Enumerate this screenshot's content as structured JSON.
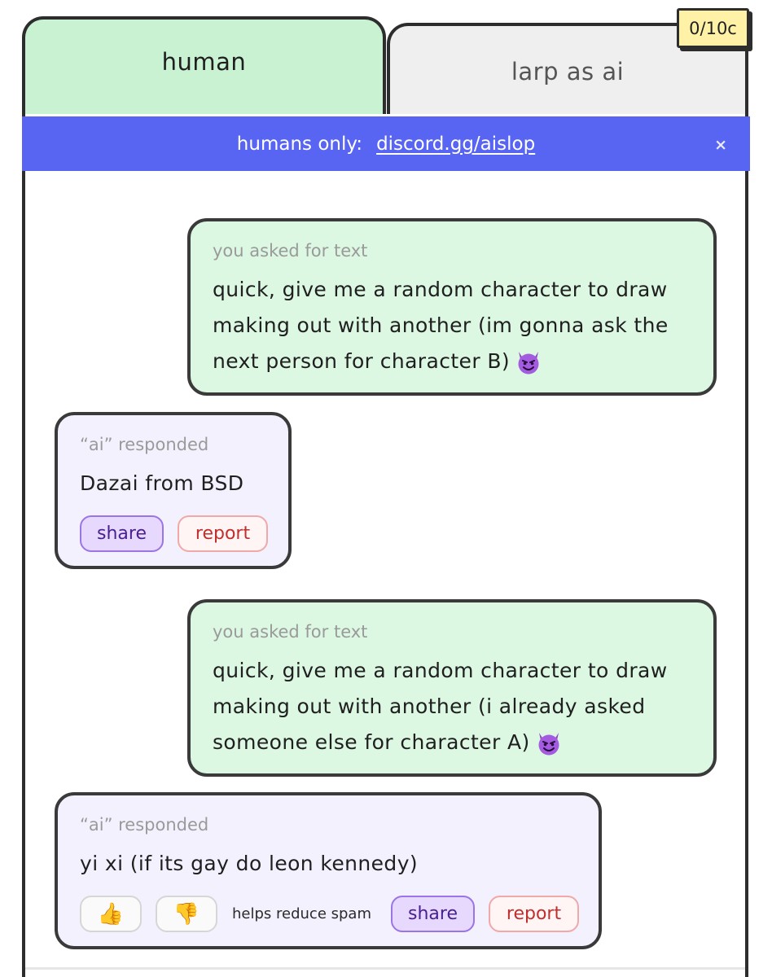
{
  "credits": "0/10c",
  "tabs": {
    "human": "human",
    "larp": "larp as ai"
  },
  "banner": {
    "label": "humans only:",
    "link_text": "discord.gg/aislop",
    "close": "×"
  },
  "messages": [
    {
      "role": "user",
      "meta": "you asked for text",
      "lines": [
        "quick, give me a random character to draw",
        "making out with another (im gonna ask the",
        "next person for character B)"
      ],
      "emoji": "devil-emoji"
    },
    {
      "role": "ai",
      "meta": "“ai” responded",
      "text": "Dazai from BSD",
      "share": "share",
      "report": "report"
    },
    {
      "role": "user",
      "meta": "you asked for text",
      "lines": [
        "quick, give me a random character to draw",
        "making out with another (i already asked",
        "someone else for character A)"
      ],
      "emoji": "devil-emoji"
    },
    {
      "role": "ai",
      "meta": "“ai” responded",
      "text": "yi xi (if its gay do leon kennedy)",
      "thumbs_up": "👍",
      "thumbs_down": "👎",
      "hint": "helps reduce spam",
      "share": "share",
      "report": "report"
    }
  ],
  "colors": {
    "human_tab": "#c9f2d2",
    "larp_tab": "#efefef",
    "banner": "#5865f2",
    "user_bubble": "#dcf7e2",
    "ai_bubble": "#f4f1fe",
    "share_bg": "#e7d9fd",
    "report_text": "#c02e2e",
    "credits_bg": "#fff1a6"
  }
}
